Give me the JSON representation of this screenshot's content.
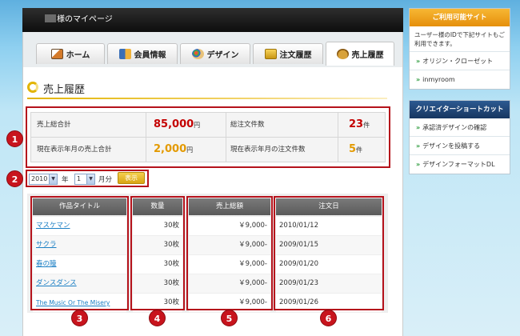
{
  "header": {
    "title": "様のマイページ"
  },
  "tabs": [
    {
      "label": "ホーム",
      "icon": "house-icon"
    },
    {
      "label": "会員情報",
      "icon": "members-icon"
    },
    {
      "label": "デザイン",
      "icon": "palette-icon"
    },
    {
      "label": "注文履歴",
      "icon": "gold-bars-icon"
    },
    {
      "label": "売上履歴",
      "icon": "moneybag-icon",
      "active": true
    }
  ],
  "page": {
    "title": "売上履歴"
  },
  "summary": {
    "total_sales_label": "売上総合計",
    "total_sales_value": "85,000",
    "total_orders_label": "総注文件数",
    "total_orders_value": "23",
    "month_sales_label": "現在表示年月の売上合計",
    "month_sales_value": "2,000",
    "month_orders_label": "現在表示年月の注文件数",
    "month_orders_value": "5",
    "yen_unit": "円",
    "count_unit": "件"
  },
  "filter": {
    "year_value": "2010",
    "year_label": "年",
    "month_value": "1",
    "month_label": "月分",
    "show_button": "表示"
  },
  "table": {
    "headers": [
      "作品タイトル",
      "数量",
      "売上総額",
      "注文日"
    ],
    "rows": [
      {
        "title": "マスケマン",
        "qty": "30枚",
        "amount": "￥9,000-",
        "date": "2010/01/12"
      },
      {
        "title": "サクラ",
        "qty": "30枚",
        "amount": "￥9,000-",
        "date": "2009/01/15"
      },
      {
        "title": "春の瞳",
        "qty": "30枚",
        "amount": "￥9,000-",
        "date": "2009/01/20"
      },
      {
        "title": "ダンスダンス",
        "qty": "30枚",
        "amount": "￥9,000-",
        "date": "2009/01/23"
      },
      {
        "title": "The Music Or The Misery",
        "qty": "30枚",
        "amount": "￥9,000-",
        "date": "2009/01/26"
      }
    ]
  },
  "markers": [
    "1",
    "2",
    "3",
    "4",
    "5",
    "6"
  ],
  "sidebar": {
    "sites": {
      "title": "ご利用可能サイト",
      "description": "ユーザー様のIDで下記サイトもご利用できます。",
      "items": [
        "オリジン・クローゼット",
        "inmyroom"
      ]
    },
    "creator": {
      "title": "クリエイターショートカット",
      "items": [
        "承認済デザインの確認",
        "デザインを投稿する",
        "デザインフォーマットDL"
      ]
    }
  },
  "colors": {
    "accent_red": "#b5121b",
    "gold": "#e2b400",
    "sidebar_orange": "#f0a51c",
    "sidebar_navy": "#1d3f6e",
    "link": "#1b7fc4"
  }
}
